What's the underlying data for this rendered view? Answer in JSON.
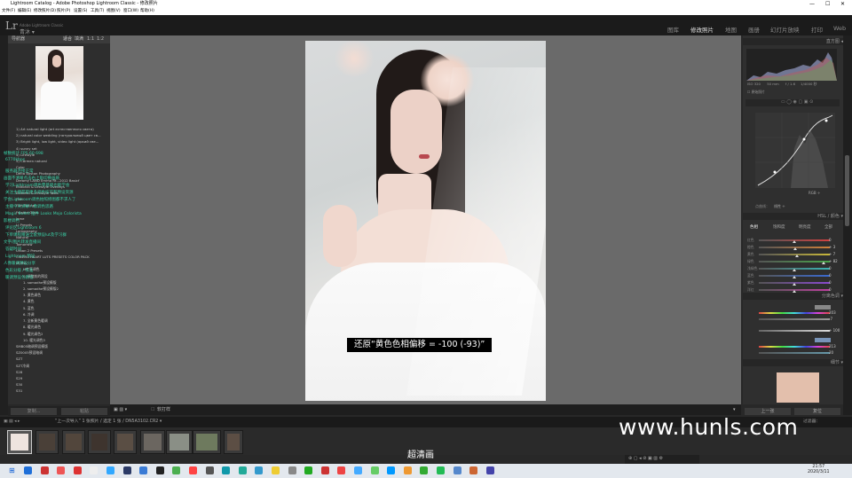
{
  "window": {
    "title": "Lightroom Catalog - Adobe Photoshop Lightroom Classic - 修改照片",
    "minimize": "—",
    "maximize": "☐",
    "close": "✕"
  },
  "menu": [
    "文件(F)",
    "编辑(E)",
    "修改照片(D)",
    "照片(P)",
    "设置(S)",
    "工具(T)",
    "视图(V)",
    "窗口(W)",
    "帮助(H)"
  ],
  "app": {
    "logo": "Lr",
    "catalog_line1": "Adobe Lightroom Classic",
    "catalog_line2": "青沐 ▾"
  },
  "modules": [
    "图库",
    "修改照片",
    "地图",
    "画册",
    "幻灯片放映",
    "打印",
    "Web"
  ],
  "left_panel": {
    "navigator_label": "导航器",
    "zoom_options": [
      "适合",
      "填满",
      "1:1",
      "1:2"
    ],
    "presets": [
      "1) Art natural light (art естественного света)",
      "2) natural color wedding (натуральный цвет св...",
      "3) Bright light, low light, video light (яркий све...",
      "4) sunny set",
      "4) Lifestyle",
      "5) Carmen natural",
      "Color",
      "Delta Boston Photography",
      "Dreamy LAND Emma Rt...2012 Basicf",
      "Editorial & Lifestyle Overlays",
      "Editorial & Lifestyle Tools",
      "Film",
      "Film Toning",
      "Frosted Glass",
      "Jame",
      "LJ Presets",
      "Lomography",
      "Natural",
      "Tomorrow",
      "Urban 2 Presets",
      "CINEMA HEART LUTS PRESETS COLOR PACK",
      "MUINU",
      "M专享调色",
      "0. 调整前的预设",
      "1. samadhe预设模版",
      "2. samadhe预设模版2",
      "3. 黄色调色",
      "4. 黄色",
      "5. 蓝色",
      "6. 冷调",
      "7. 全新黄色暖调",
      "8. 暖光调色",
      "9. 暖光调色2",
      "10. 暖光调色3",
      "SMB05暗调预设模版",
      "SZ0005预设暗调",
      "SZT",
      "SZT冷调",
      "S28",
      "S29",
      "S30",
      "S31"
    ],
    "overlay_lines": [
      "帧数统计  FPS  60          698",
      "                          6770kbps",
      "服务器连接正常",
      "画面不清晰点击右上角切换画质",
      "学习Lightroom调色零基础也能学会",
      "关注主播获取更多调色技巧和预设资源",
      "学会Lightroom调色拍照修图都不求人了",
      "主播今天讲解人像调色思路",
      "Magic Bullet 插件 Looks Mojo Colorista",
      "影楼调色",
      "评论区Lightroom 6",
      "下单课程赠送全套预设lut及学习群",
      "文字/图片转发直播间",
      "答疑时间",
      "Lightroom 预设",
      "人像暖调预设分享",
      "色彩分级 / 校准",
      "暖调预设包教程"
    ],
    "footer": {
      "copy_label": "复制...",
      "paste_label": "粘贴"
    }
  },
  "photo": {
    "subtitle": "还原“黄色色相偏移 = -100 (-93)”"
  },
  "toolbar": {
    "view_modes": "▣  ▥  ▾",
    "softproof_label": "软打样"
  },
  "right_panel": {
    "histogram_label": "直方图",
    "histogram_info": [
      "ISO 320",
      "50 mm",
      "f / 1.6",
      "1/4000 秒"
    ],
    "original_label": "原始照片",
    "tone_curve_channel": "RGB ÷",
    "point_curve_label": "点曲线：",
    "point_curve_value": "线性 ÷",
    "hsl_header": "HSL / 颜色",
    "hsl_tabs": [
      "色相",
      "饱和度",
      "明亮度",
      "全部"
    ],
    "hsl_rows": [
      {
        "label": "红色",
        "value": "0",
        "color": "#d04040"
      },
      {
        "label": "橙色",
        "value": "+ 3",
        "color": "#d0803a"
      },
      {
        "label": "黄色",
        "value": "+ 7",
        "color": "#c9b83a"
      },
      {
        "label": "绿色",
        "value": "+ 82",
        "color": "#49a449"
      },
      {
        "label": "浅绿色",
        "value": "0",
        "color": "#3ab4b4"
      },
      {
        "label": "蓝色",
        "value": "0",
        "color": "#3a6ad0"
      },
      {
        "label": "紫色",
        "value": "0",
        "color": "#8a4ad0"
      },
      {
        "label": "洋红",
        "value": "0",
        "color": "#c040a0"
      }
    ],
    "split_toning_header": "分离色调",
    "split_values": [
      "203",
      "-7",
      "+ 100",
      "213",
      "20"
    ],
    "detail_header": "细节",
    "prev_button": "上一张",
    "reset_button": "复位"
  },
  "filmstrip": {
    "bar_text": "“上一次导入” 1 张照片 / 选定 1 张 / DN5A3102.CR2 ▾",
    "filter_label": "过滤器："
  },
  "watermark": "www.hunls.com",
  "caption": "超清画",
  "clock": {
    "time": "21:57",
    "date": "2020/3/11"
  }
}
